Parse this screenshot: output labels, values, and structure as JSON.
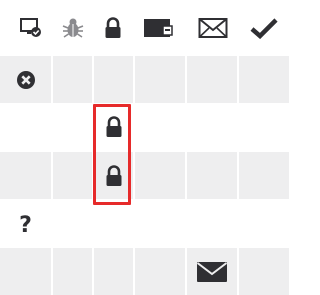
{
  "header": {
    "columns": [
      {
        "icon": "monitor-check-icon"
      },
      {
        "icon": "bug-icon"
      },
      {
        "icon": "lock-icon"
      },
      {
        "icon": "archive-box-icon"
      },
      {
        "icon": "envelope-icon"
      },
      {
        "icon": "checkmark-icon"
      }
    ]
  },
  "rows": [
    {
      "cells": [
        "x-circle-icon",
        "",
        "",
        "",
        "",
        "",
        ""
      ]
    },
    {
      "cells": [
        "",
        "",
        "lock-icon",
        "",
        "",
        "",
        ""
      ]
    },
    {
      "cells": [
        "",
        "",
        "lock-icon",
        "",
        "",
        "",
        ""
      ]
    },
    {
      "cells": [
        "question-mark",
        "",
        "",
        "",
        "",
        "",
        ""
      ]
    },
    {
      "cells": [
        "",
        "",
        "",
        "",
        "envelope-icon",
        "",
        ""
      ]
    }
  ],
  "question_mark_text": "?",
  "highlight_color": "#e62a2a",
  "icon_color": "#2f2f33",
  "row_shade_color": "#eeeeef"
}
